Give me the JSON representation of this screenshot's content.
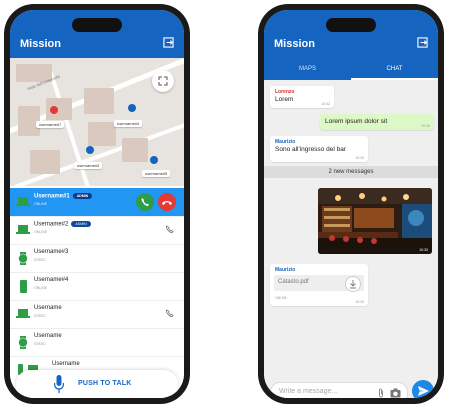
{
  "colors": {
    "primary": "#1565c0",
    "accent": "#2196f3",
    "call_accept": "#2e9d47",
    "call_decline": "#e53935",
    "my_bubble": "#dcf8c6"
  },
  "left_phone": {
    "app_title": "Mission",
    "map": {
      "street_label": "Viale dell'Università",
      "markers": [
        {
          "label": "username#7",
          "color": "#e53935"
        },
        {
          "label": "username#4",
          "color": "#1565c0"
        },
        {
          "label": "username#3",
          "color": "#1565c0"
        },
        {
          "label": "username#5",
          "color": "#1565c0"
        }
      ]
    },
    "users": [
      {
        "name": "Username#1",
        "badge": "ADMIN",
        "status": "ONLINE",
        "device": "laptop-icon",
        "selected": true
      },
      {
        "name": "Username#2",
        "badge": "ADMIN",
        "status": "ONLINE",
        "device": "laptop-icon"
      },
      {
        "name": "Username#3",
        "badge": "",
        "status": "STATIC",
        "device": "watch-icon"
      },
      {
        "name": "Username#4",
        "badge": "",
        "status": "ONLINE",
        "device": "phone-icon"
      },
      {
        "name": "Username",
        "badge": "",
        "status": "STATIC",
        "device": "laptop-icon"
      },
      {
        "name": "Username",
        "badge": "",
        "status": "STATIC",
        "device": "watch-icon"
      },
      {
        "name": "Username",
        "badge": "",
        "status": "",
        "device": "phone-icon"
      }
    ],
    "ptt_label": "PUSH TO TALK"
  },
  "right_phone": {
    "app_title": "Mission",
    "tabs": [
      "MAPS",
      "CHAT"
    ],
    "active_tab": "CHAT",
    "messages": [
      {
        "sender": "Lorenzo",
        "text": "Lorem",
        "time": "10:32",
        "mine": false
      },
      {
        "sender": "",
        "text": "Lorem ipsum dolor sit",
        "time": "10:33",
        "mine": true
      },
      {
        "sender": "Maurizio",
        "text": "Sono all'ingresso del bar",
        "time": "10:33",
        "mine": false
      }
    ],
    "new_messages_label": "2 new messages",
    "photo_time": "10:33",
    "file_message": {
      "sender": "Maurizio",
      "filename": "Catasto.pdf",
      "size": "158 KB",
      "time": "10:33"
    },
    "composer_placeholder": "Write a message..."
  }
}
